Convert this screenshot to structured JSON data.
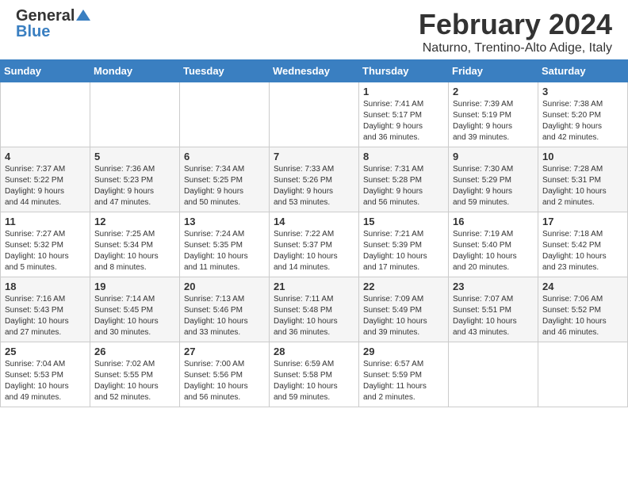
{
  "header": {
    "logo_general": "General",
    "logo_blue": "Blue",
    "main_title": "February 2024",
    "subtitle": "Naturno, Trentino-Alto Adige, Italy"
  },
  "calendar": {
    "days_of_week": [
      "Sunday",
      "Monday",
      "Tuesday",
      "Wednesday",
      "Thursday",
      "Friday",
      "Saturday"
    ],
    "weeks": [
      [
        {
          "day": "",
          "info": ""
        },
        {
          "day": "",
          "info": ""
        },
        {
          "day": "",
          "info": ""
        },
        {
          "day": "",
          "info": ""
        },
        {
          "day": "1",
          "info": "Sunrise: 7:41 AM\nSunset: 5:17 PM\nDaylight: 9 hours\nand 36 minutes."
        },
        {
          "day": "2",
          "info": "Sunrise: 7:39 AM\nSunset: 5:19 PM\nDaylight: 9 hours\nand 39 minutes."
        },
        {
          "day": "3",
          "info": "Sunrise: 7:38 AM\nSunset: 5:20 PM\nDaylight: 9 hours\nand 42 minutes."
        }
      ],
      [
        {
          "day": "4",
          "info": "Sunrise: 7:37 AM\nSunset: 5:22 PM\nDaylight: 9 hours\nand 44 minutes."
        },
        {
          "day": "5",
          "info": "Sunrise: 7:36 AM\nSunset: 5:23 PM\nDaylight: 9 hours\nand 47 minutes."
        },
        {
          "day": "6",
          "info": "Sunrise: 7:34 AM\nSunset: 5:25 PM\nDaylight: 9 hours\nand 50 minutes."
        },
        {
          "day": "7",
          "info": "Sunrise: 7:33 AM\nSunset: 5:26 PM\nDaylight: 9 hours\nand 53 minutes."
        },
        {
          "day": "8",
          "info": "Sunrise: 7:31 AM\nSunset: 5:28 PM\nDaylight: 9 hours\nand 56 minutes."
        },
        {
          "day": "9",
          "info": "Sunrise: 7:30 AM\nSunset: 5:29 PM\nDaylight: 9 hours\nand 59 minutes."
        },
        {
          "day": "10",
          "info": "Sunrise: 7:28 AM\nSunset: 5:31 PM\nDaylight: 10 hours\nand 2 minutes."
        }
      ],
      [
        {
          "day": "11",
          "info": "Sunrise: 7:27 AM\nSunset: 5:32 PM\nDaylight: 10 hours\nand 5 minutes."
        },
        {
          "day": "12",
          "info": "Sunrise: 7:25 AM\nSunset: 5:34 PM\nDaylight: 10 hours\nand 8 minutes."
        },
        {
          "day": "13",
          "info": "Sunrise: 7:24 AM\nSunset: 5:35 PM\nDaylight: 10 hours\nand 11 minutes."
        },
        {
          "day": "14",
          "info": "Sunrise: 7:22 AM\nSunset: 5:37 PM\nDaylight: 10 hours\nand 14 minutes."
        },
        {
          "day": "15",
          "info": "Sunrise: 7:21 AM\nSunset: 5:39 PM\nDaylight: 10 hours\nand 17 minutes."
        },
        {
          "day": "16",
          "info": "Sunrise: 7:19 AM\nSunset: 5:40 PM\nDaylight: 10 hours\nand 20 minutes."
        },
        {
          "day": "17",
          "info": "Sunrise: 7:18 AM\nSunset: 5:42 PM\nDaylight: 10 hours\nand 23 minutes."
        }
      ],
      [
        {
          "day": "18",
          "info": "Sunrise: 7:16 AM\nSunset: 5:43 PM\nDaylight: 10 hours\nand 27 minutes."
        },
        {
          "day": "19",
          "info": "Sunrise: 7:14 AM\nSunset: 5:45 PM\nDaylight: 10 hours\nand 30 minutes."
        },
        {
          "day": "20",
          "info": "Sunrise: 7:13 AM\nSunset: 5:46 PM\nDaylight: 10 hours\nand 33 minutes."
        },
        {
          "day": "21",
          "info": "Sunrise: 7:11 AM\nSunset: 5:48 PM\nDaylight: 10 hours\nand 36 minutes."
        },
        {
          "day": "22",
          "info": "Sunrise: 7:09 AM\nSunset: 5:49 PM\nDaylight: 10 hours\nand 39 minutes."
        },
        {
          "day": "23",
          "info": "Sunrise: 7:07 AM\nSunset: 5:51 PM\nDaylight: 10 hours\nand 43 minutes."
        },
        {
          "day": "24",
          "info": "Sunrise: 7:06 AM\nSunset: 5:52 PM\nDaylight: 10 hours\nand 46 minutes."
        }
      ],
      [
        {
          "day": "25",
          "info": "Sunrise: 7:04 AM\nSunset: 5:53 PM\nDaylight: 10 hours\nand 49 minutes."
        },
        {
          "day": "26",
          "info": "Sunrise: 7:02 AM\nSunset: 5:55 PM\nDaylight: 10 hours\nand 52 minutes."
        },
        {
          "day": "27",
          "info": "Sunrise: 7:00 AM\nSunset: 5:56 PM\nDaylight: 10 hours\nand 56 minutes."
        },
        {
          "day": "28",
          "info": "Sunrise: 6:59 AM\nSunset: 5:58 PM\nDaylight: 10 hours\nand 59 minutes."
        },
        {
          "day": "29",
          "info": "Sunrise: 6:57 AM\nSunset: 5:59 PM\nDaylight: 11 hours\nand 2 minutes."
        },
        {
          "day": "",
          "info": ""
        },
        {
          "day": "",
          "info": ""
        }
      ]
    ]
  }
}
